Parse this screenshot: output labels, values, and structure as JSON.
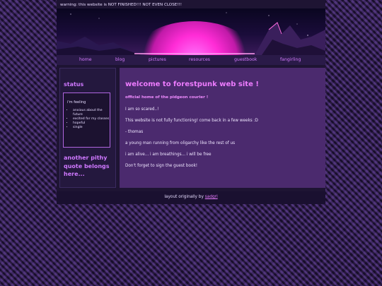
{
  "warning": "warning: this website is NOT FINISHED!!! NOT EVEN CLOSE!!!",
  "nav": [
    "home",
    "blog",
    "pictures",
    "resources",
    "guestbook",
    "fangirling"
  ],
  "sidebar": {
    "title": "status",
    "feeling_label": "i'm feeling",
    "feelings": [
      "anxious about the future",
      "excited for my classes",
      "hopeful",
      "single"
    ],
    "quote": "another pithy quote belongs here..."
  },
  "main": {
    "title": "welcome to forestpunk web site !",
    "subtitle": "official home of the pidgeon courier !",
    "paragraphs": [
      "I am so scared..!",
      "This website is not fully functioning! come back in a few weeks :D",
      "- thomas",
      "a young man running from oligarchy like the rest of us",
      "i am alive... i am breathings... i will be free",
      "Don't forget to sign the guest book!"
    ]
  },
  "footer": {
    "prefix": "layout originally by",
    "author": "sadgrl"
  },
  "colors": {
    "accent": "#cf78ff",
    "background": "#2a1a44",
    "panel": "#4b2a6e"
  }
}
